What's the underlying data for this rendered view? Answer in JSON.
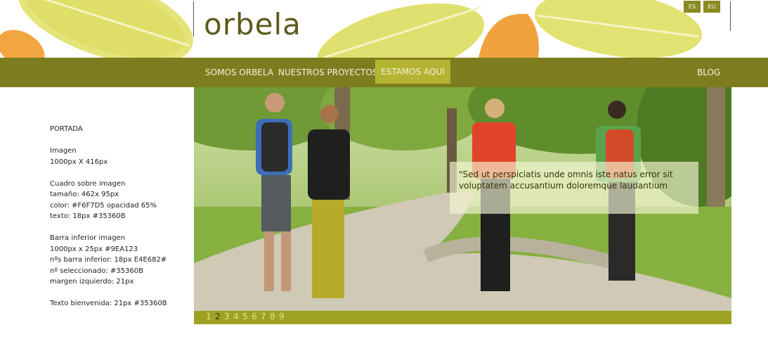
{
  "brand": {
    "logo_text": "orbela"
  },
  "languages": [
    {
      "label": "ES"
    },
    {
      "label": "EU"
    }
  ],
  "nav": {
    "items": [
      {
        "label": "SOMOS ORBELA"
      },
      {
        "label": "NUESTROS PROYECTOS"
      },
      {
        "label": "ESTAMOS AQUÍ"
      }
    ],
    "selected_index": 2,
    "blog_label": "BLOG"
  },
  "spec": {
    "portada": "PORTADA",
    "imagen_title": "Imagen",
    "imagen_size": "1000px X 416px",
    "cuadro_title": "Cuadro sobre imagen",
    "cuadro_size": "tamaño: 462x 95px",
    "cuadro_color": "color: #F6F7D5  opacidad 65%",
    "cuadro_text": "texto: 18px  #35360B",
    "barra_title": "Barra inferior imagen",
    "barra_size": "1000px x 25px #9EA123",
    "barra_nums": "nºs barra inferior: 18px  E4E682#",
    "barra_selected": "nº seleccionado: #35360B",
    "barra_margin": "margen izquierdo: 21px",
    "bienvenida": "Texto bienvenida: 21px #35360B"
  },
  "hero": {
    "quote": "\"Sed ut perspiciatis unde omnis iste natus error sit voluptatem accusantium doloremque laudantium",
    "overlay_color": "#F6F7D5",
    "overlay_opacity": 0.65
  },
  "pager": {
    "numbers": [
      "1",
      "2",
      "3",
      "4",
      "5",
      "6",
      "7",
      "8",
      "9"
    ],
    "selected_index": 1,
    "bar_color": "#9EA123",
    "num_color": "#E4E682",
    "selected_color": "#35360B"
  }
}
